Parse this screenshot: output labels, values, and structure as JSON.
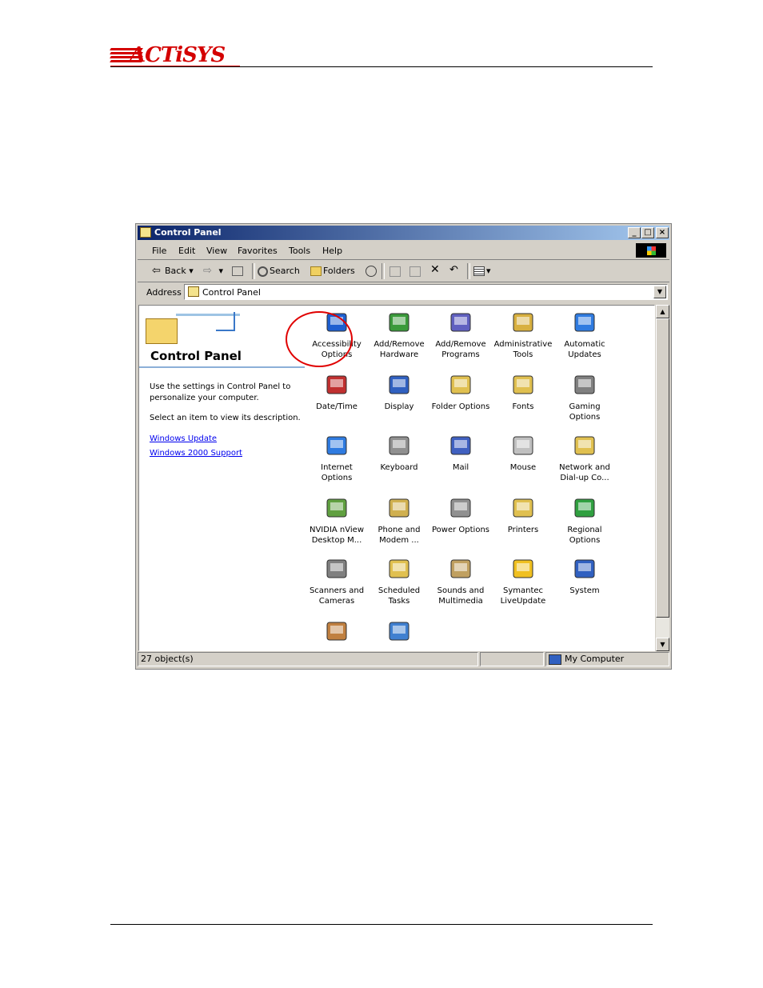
{
  "document": {
    "logo_text": "ACTiSYS"
  },
  "window": {
    "title": "Control Panel",
    "controls": {
      "minimize": "_",
      "maximize": "□",
      "close": "×"
    }
  },
  "menu": [
    "File",
    "Edit",
    "View",
    "Favorites",
    "Tools",
    "Help"
  ],
  "toolbar": {
    "back": "Back",
    "search": "Search",
    "folders": "Folders"
  },
  "address": {
    "label": "Address",
    "value": "Control Panel"
  },
  "left_pane": {
    "title": "Control Panel",
    "description": "Use the settings in Control Panel to personalize your computer.",
    "select_hint": "Select an item to view its description.",
    "links": [
      "Windows Update",
      "Windows 2000 Support"
    ]
  },
  "icons": [
    {
      "line1": "Accessibility",
      "line2": "Options",
      "icon": "accessibility-icon",
      "color": "#1e5fd0"
    },
    {
      "line1": "Add/Remove",
      "line2": "Hardware",
      "icon": "hardware-icon",
      "color": "#3a9a3a"
    },
    {
      "line1": "Add/Remove",
      "line2": "Programs",
      "icon": "programs-icon",
      "color": "#6060c0"
    },
    {
      "line1": "Administrative",
      "line2": "Tools",
      "icon": "admin-tools-icon",
      "color": "#d8b040"
    },
    {
      "line1": "Automatic",
      "line2": "Updates",
      "icon": "updates-icon",
      "color": "#2f7be0"
    },
    {
      "line1": "Date/Time",
      "line2": "",
      "icon": "datetime-icon",
      "color": "#c03030"
    },
    {
      "line1": "Display",
      "line2": "",
      "icon": "display-icon",
      "color": "#3060c0"
    },
    {
      "line1": "Folder Options",
      "line2": "",
      "icon": "folder-options-icon",
      "color": "#e0c050"
    },
    {
      "line1": "Fonts",
      "line2": "",
      "icon": "fonts-icon",
      "color": "#e0c050"
    },
    {
      "line1": "Gaming",
      "line2": "Options",
      "icon": "gaming-icon",
      "color": "#808080"
    },
    {
      "line1": "Internet",
      "line2": "Options",
      "icon": "internet-icon",
      "color": "#2f7be0"
    },
    {
      "line1": "Keyboard",
      "line2": "",
      "icon": "keyboard-icon",
      "color": "#909090"
    },
    {
      "line1": "Mail",
      "line2": "",
      "icon": "mail-icon",
      "color": "#4060c0"
    },
    {
      "line1": "Mouse",
      "line2": "",
      "icon": "mouse-icon",
      "color": "#c0c0c0"
    },
    {
      "line1": "Network and",
      "line2": "Dial-up Co...",
      "icon": "network-icon",
      "color": "#e0c050"
    },
    {
      "line1": "NVIDIA nView",
      "line2": "Desktop M...",
      "icon": "nvidia-icon",
      "color": "#60a040"
    },
    {
      "line1": "Phone and",
      "line2": "Modem ...",
      "icon": "phone-icon",
      "color": "#d0b050"
    },
    {
      "line1": "Power Options",
      "line2": "",
      "icon": "power-icon",
      "color": "#909090"
    },
    {
      "line1": "Printers",
      "line2": "",
      "icon": "printers-icon",
      "color": "#e0c050"
    },
    {
      "line1": "Regional",
      "line2": "Options",
      "icon": "regional-icon",
      "color": "#30a040"
    },
    {
      "line1": "Scanners and",
      "line2": "Cameras",
      "icon": "scanner-icon",
      "color": "#808080"
    },
    {
      "line1": "Scheduled",
      "line2": "Tasks",
      "icon": "scheduled-icon",
      "color": "#e0c050"
    },
    {
      "line1": "Sounds and",
      "line2": "Multimedia",
      "icon": "sounds-icon",
      "color": "#c0a060"
    },
    {
      "line1": "Symantec",
      "line2": "LiveUpdate",
      "icon": "symantec-icon",
      "color": "#f0c020"
    },
    {
      "line1": "System",
      "line2": "",
      "icon": "system-icon",
      "color": "#3060c0"
    },
    {
      "line1": "",
      "line2": "",
      "icon": "users-icon",
      "color": "#c08040"
    },
    {
      "line1": "",
      "line2": "",
      "icon": "wireless-icon",
      "color": "#4080d0"
    }
  ],
  "status": {
    "objects": "27 object(s)",
    "zone": "My Computer"
  }
}
